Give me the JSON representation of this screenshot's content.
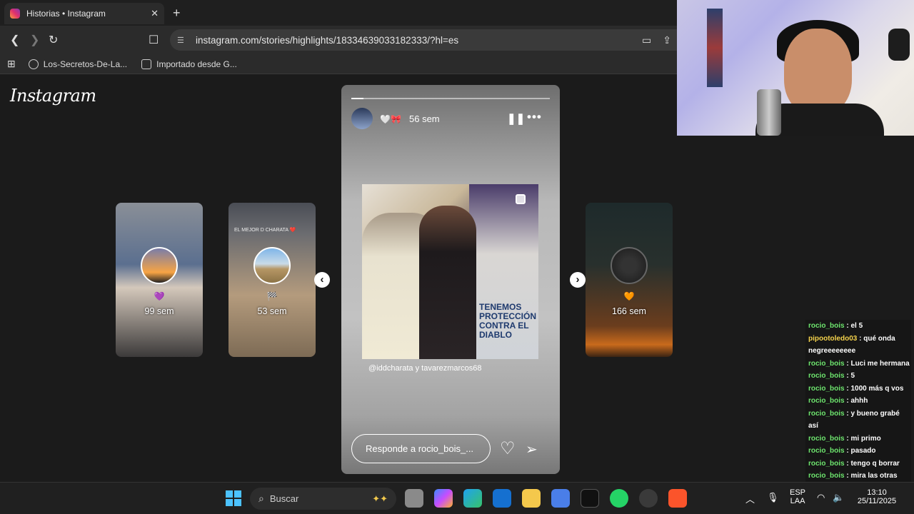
{
  "browser": {
    "tab_title": "Historias • Instagram",
    "url": "instagram.com/stories/highlights/18334639033182333/?hl=es",
    "bookmarks": [
      "Los-Secretos-De-La...",
      "Importado desde G..."
    ]
  },
  "instagram": {
    "logo": "Instagram",
    "thumbnails": [
      {
        "emoji": "💜",
        "age": "99 sem"
      },
      {
        "emoji": "🏁",
        "age": "53 sem",
        "topline": "EL MEJOR D CHARATA ❤️"
      },
      {
        "emoji": "🧡",
        "age": "166 sem"
      }
    ],
    "story": {
      "emoji": "🤍🎀",
      "time": "56 sem",
      "caption": "TENEMOS PROTECCIÓN CONTRA EL DIABLO",
      "mention": "@iddcharata y tavarezmarcos68",
      "reply_placeholder": "Responde a rocio_bois_...",
      "progress": 0.06
    }
  },
  "chat": [
    {
      "user": "rocio_bois",
      "msg": " : el 5"
    },
    {
      "user": "pipootoledo03",
      "msg": " : qué onda negreeeeeeee",
      "alt": true
    },
    {
      "user": "rocio_bois",
      "msg": " : Luci me hermana"
    },
    {
      "user": "rocio_bois",
      "msg": " : 5"
    },
    {
      "user": "rocio_bois",
      "msg": " : 1000 más q vos"
    },
    {
      "user": "rocio_bois",
      "msg": " : ahhh"
    },
    {
      "user": "rocio_bois",
      "msg": " : y bueno grabé así"
    },
    {
      "user": "rocio_bois",
      "msg": " : mi primo"
    },
    {
      "user": "rocio_bois",
      "msg": " : pasado"
    },
    {
      "user": "rocio_bois",
      "msg": " : tengo q borrar"
    },
    {
      "user": "rocio_bois",
      "msg": " : mira las otras jajajja"
    }
  ],
  "taskbar": {
    "search": "Buscar",
    "lang_top": "ESP",
    "lang_bottom": "LAA",
    "time": "13:10",
    "date": "25/11/2025"
  }
}
